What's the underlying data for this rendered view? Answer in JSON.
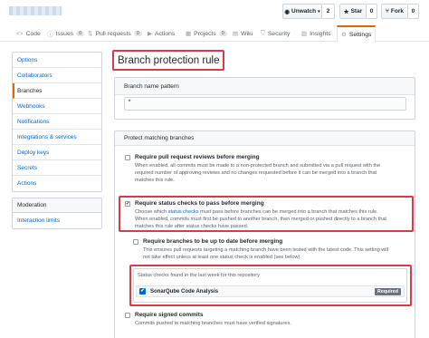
{
  "header": {
    "unwatch_label": "Unwatch",
    "unwatch_count": "2",
    "star_label": "Star",
    "star_count": "0",
    "fork_label": "Fork",
    "fork_count": "0"
  },
  "tabs": [
    {
      "label": "Code",
      "icon": "code-icon"
    },
    {
      "label": "Issues",
      "count": "0",
      "icon": "issue-icon"
    },
    {
      "label": "Pull requests",
      "count": "0",
      "icon": "pull-request-icon"
    },
    {
      "label": "Actions",
      "icon": "play-icon"
    },
    {
      "label": "Projects",
      "count": "0",
      "icon": "project-icon"
    },
    {
      "label": "Wiki",
      "icon": "book-icon"
    },
    {
      "label": "Security",
      "icon": "shield-icon"
    },
    {
      "label": "Insights",
      "icon": "graph-icon"
    },
    {
      "label": "Settings",
      "icon": "gear-icon",
      "selected": true
    }
  ],
  "sidebar": {
    "items": [
      "Options",
      "Collaborators",
      "Branches",
      "Webhooks",
      "Notifications",
      "Integrations & services",
      "Deploy keys",
      "Secrets",
      "Actions"
    ],
    "active": "Branches"
  },
  "sidebar2": {
    "heading": "Moderation",
    "items": [
      "Interaction limits"
    ]
  },
  "main": {
    "title": "Branch protection rule",
    "pattern_label": "Branch name pattern",
    "pattern_value": "*",
    "protect_heading": "Protect matching branches",
    "opt_reviews": {
      "label": "Require pull request reviews before merging",
      "desc1": "When enabled, all commits must be made to a non-protected branch and submitted via a pull request with the",
      "desc2": "required number of approving reviews and no changes requested before it can be merged into a branch that",
      "desc3": "matches this rule."
    },
    "opt_status": {
      "label": "Require status checks to pass before merging",
      "desc1a": "Choose which ",
      "desc1link": "status checks",
      "desc1b": " must pass before branches can be merged into a branch that matches this rule.",
      "desc2": "When enabled, commits must first be pushed to another branch, then merged or pushed directly to a branch that",
      "desc3": "matches this rule after status checks have passed."
    },
    "opt_uptodate": {
      "label": "Require branches to be up to date before merging",
      "desc1": "This ensures pull requests targeting a matching branch have been tested with the latest code. This setting will",
      "desc2": "not take effect unless at least one status check is enabled (see below)."
    },
    "checks": {
      "heading": "Status checks found in the last week for this repository",
      "name": "SonarQube Code Analysis",
      "badge": "Required"
    },
    "opt_signed": {
      "label": "Require signed commits",
      "desc1": "Commits pushed to matching branches must have verified signatures."
    }
  }
}
